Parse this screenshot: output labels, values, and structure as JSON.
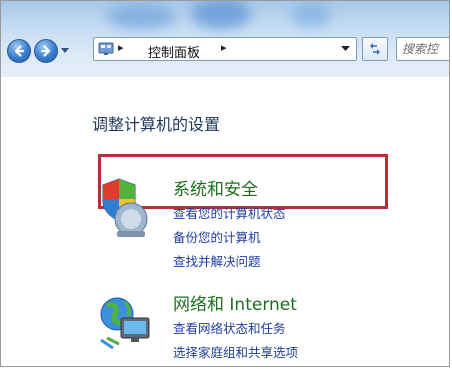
{
  "address_bar": {
    "separator": "▸",
    "crumb": "控制面板"
  },
  "search": {
    "placeholder": "搜索控"
  },
  "content": {
    "heading": "调整计算机的设置",
    "categories": [
      {
        "title": "系统和安全",
        "icon": "shield-icon",
        "links": [
          "查看您的计算机状态",
          "备份您的计算机",
          "查找并解决问题"
        ]
      },
      {
        "title": "网络和 Internet",
        "icon": "network-globe-icon",
        "links": [
          "查看网络状态和任务",
          "选择家庭组和共享选项"
        ]
      }
    ]
  },
  "colors": {
    "highlight_border": "#b0323a",
    "category_title": "#1e6e1e",
    "link": "#1e3fa0"
  }
}
